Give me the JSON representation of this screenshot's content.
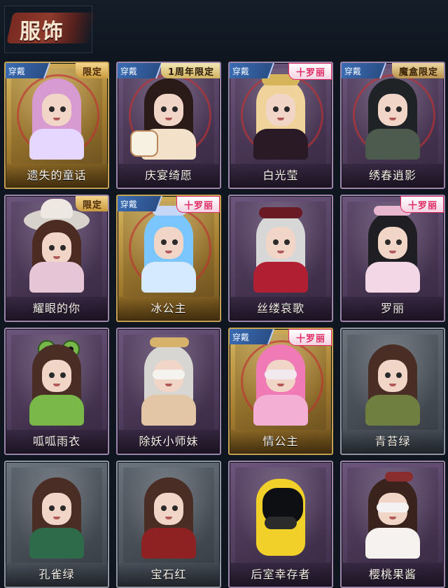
{
  "header": {
    "title": "服饰"
  },
  "tags": {
    "wear": "穿戴"
  },
  "cards": [
    {
      "name": "遗失的童话",
      "frame": "gold",
      "wear": true,
      "badge": {
        "type": "limit",
        "text": "限定"
      }
    },
    {
      "name": "庆宴绮愿",
      "frame": "purple",
      "wear": true,
      "badge": {
        "type": "anniv",
        "text": "1周年限定"
      }
    },
    {
      "name": "白光莹",
      "frame": "purple",
      "wear": true,
      "badge": {
        "type": "lolita",
        "text": "十罗丽"
      }
    },
    {
      "name": "绣春逍影",
      "frame": "purple",
      "wear": true,
      "badge": {
        "type": "box",
        "text": "魔盒限定"
      }
    },
    {
      "name": "耀眼的你",
      "frame": "purple",
      "wear": false,
      "badge": {
        "type": "limit",
        "text": "限定"
      }
    },
    {
      "name": "冰公主",
      "frame": "gold",
      "wear": true,
      "badge": {
        "type": "lolita",
        "text": "十罗丽"
      }
    },
    {
      "name": "丝缕哀歌",
      "frame": "purple",
      "wear": false,
      "badge": null
    },
    {
      "name": "罗丽",
      "frame": "purple",
      "wear": false,
      "badge": {
        "type": "lolita",
        "text": "十罗丽"
      }
    },
    {
      "name": "呱呱雨衣",
      "frame": "purple",
      "wear": false,
      "badge": null
    },
    {
      "name": "除妖小师妹",
      "frame": "purple",
      "wear": false,
      "badge": null
    },
    {
      "name": "情公主",
      "frame": "gold",
      "wear": true,
      "badge": {
        "type": "lolita",
        "text": "十罗丽"
      }
    },
    {
      "name": "青苔绿",
      "frame": "gray",
      "wear": false,
      "badge": null
    },
    {
      "name": "孔雀绿",
      "frame": "gray",
      "wear": false,
      "badge": null
    },
    {
      "name": "宝石红",
      "frame": "gray",
      "wear": false,
      "badge": null
    },
    {
      "name": "后室幸存者",
      "frame": "purple",
      "wear": false,
      "badge": null
    },
    {
      "name": "樱桃果酱",
      "frame": "purple",
      "wear": false,
      "badge": null
    }
  ],
  "colors": {
    "gold_frame": "#c8a253",
    "purple_frame": "#9d86a9",
    "gray_frame": "#8f98a3",
    "wear_tag": "#3b6db6",
    "lolita_badge": "#e12b63"
  }
}
